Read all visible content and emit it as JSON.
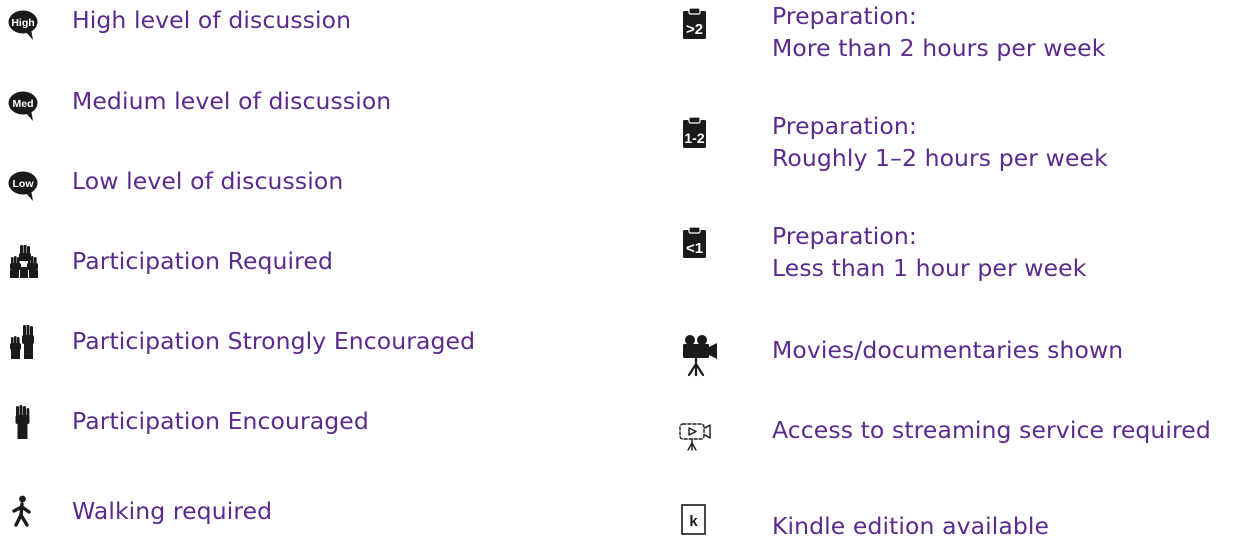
{
  "legend": {
    "left": [
      {
        "icon": "high-discussion-bubble-icon",
        "badge": "High",
        "label": "High level of discussion"
      },
      {
        "icon": "medium-discussion-bubble-icon",
        "badge": "Med",
        "label": "Medium level of discussion"
      },
      {
        "icon": "low-discussion-bubble-icon",
        "badge": "Low",
        "label": "Low level of discussion"
      },
      {
        "icon": "many-raised-hands-icon",
        "label": "Participation Required"
      },
      {
        "icon": "two-raised-hands-icon",
        "label": "Participation Strongly Encouraged"
      },
      {
        "icon": "single-raised-hand-icon",
        "label": "Participation Encouraged"
      },
      {
        "icon": "walking-person-icon",
        "label": "Walking required"
      }
    ],
    "right": [
      {
        "icon": "clipboard-more-than-2-icon",
        "badge": ">2",
        "line1": "Preparation:",
        "line2": "More than 2 hours per week"
      },
      {
        "icon": "clipboard-1-2-icon",
        "badge": "1-2",
        "line1": "Preparation:",
        "line2": "Roughly 1–2 hours per week"
      },
      {
        "icon": "clipboard-less-than-1-icon",
        "badge": "<1",
        "line1": "Preparation:",
        "line2": "Less than 1 hour per week"
      },
      {
        "icon": "movie-camera-icon",
        "label": "Movies/documentaries shown"
      },
      {
        "icon": "streaming-camera-icon",
        "label": "Access to streaming service required"
      },
      {
        "icon": "kindle-icon",
        "badge": "k",
        "label": "Kindle edition available"
      }
    ]
  },
  "colors": {
    "label": "#5b2a8c",
    "icon": "#1a1a1a"
  }
}
